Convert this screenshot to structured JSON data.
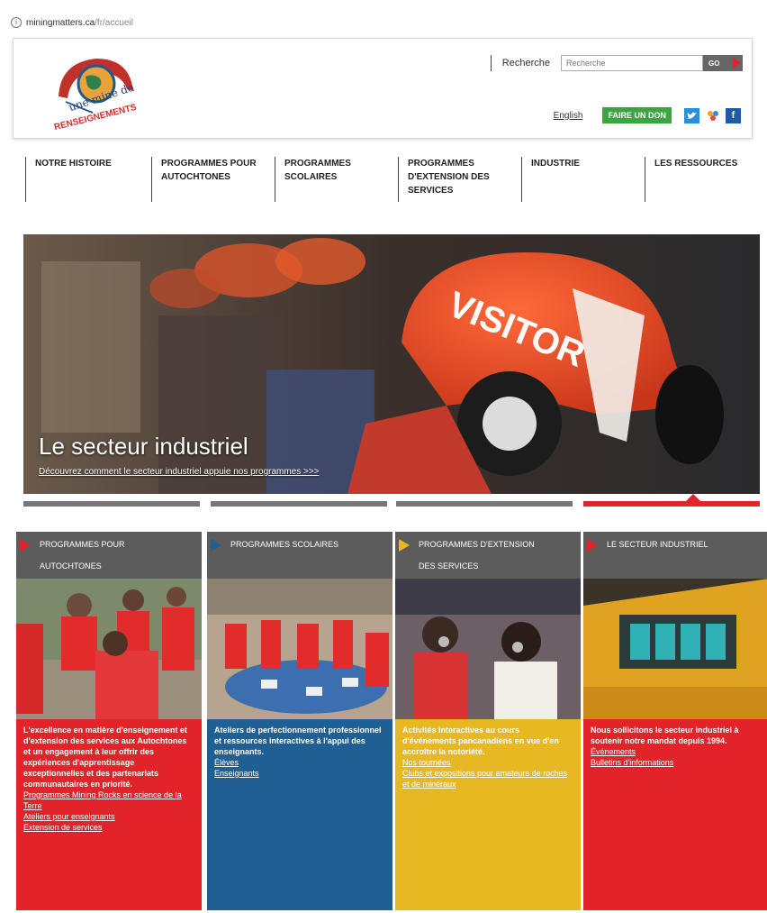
{
  "browser": {
    "url_host": "miningmatters.ca",
    "url_path": "/fr/accueil"
  },
  "header": {
    "logo_line1": "une mine de",
    "logo_line2": "RENSEIGNEMENTS",
    "search_label": "Recherche",
    "search_placeholder": "Recherche",
    "go_label": "GO",
    "english_label": "English",
    "donate_label": "FAIRE UN DON"
  },
  "nav": {
    "items": [
      {
        "label": "NOTRE HISTOIRE"
      },
      {
        "label": "PROGRAMMES POUR AUTOCHTONES"
      },
      {
        "label": "PROGRAMMES SCOLAIRES"
      },
      {
        "label": "PROGRAMMES D'EXTENSION DES SERVICES"
      },
      {
        "label": "INDUSTRIE"
      },
      {
        "label": "LES RESSOURCES"
      }
    ]
  },
  "hero": {
    "title": "Le secteur industriel",
    "subtitle": "Découvrez comment le secteur industriel appuie nos programmes >>>",
    "helmet_text": "VISITOR",
    "active_slide": 4,
    "slide_count": 4
  },
  "cards": [
    {
      "title_line1": "PROGRAMMES POUR",
      "title_line2": "AUTOCHTONES",
      "description": "L'excellence en matière d'enseignement et d'extension des services aux Autochtones et un engagement à leur offrir des expériences d'apprentissage exceptionnelles et des partenariats communautaires en priorité.",
      "links": [
        "Programmes Mining Rocks en science de la Terre",
        "Ateliers pour enseignants",
        "Extension de services"
      ],
      "color": "#e2242a"
    },
    {
      "title_line1": "PROGRAMMES SCOLAIRES",
      "title_line2": "",
      "description": "Ateliers de perfectionnement professionnel et ressources interactives à l'appui des enseignants.",
      "links": [
        "Élèves",
        "Enseignants"
      ],
      "color": "#1f5f94"
    },
    {
      "title_line1": "PROGRAMMES D'EXTENSION",
      "title_line2": "DES SERVICES",
      "description": "Activités interactives au cours d'événements pancanadiens en vue d'en accroître la notoriété.",
      "links": [
        "Nos tournées",
        "Clubs et expositions pour amateurs de roches et de minéraux"
      ],
      "color": "#e7b822"
    },
    {
      "title_line1": "LE SECTEUR INDUSTRIEL",
      "title_line2": "",
      "description": "Nous sollicitons le secteur industriel à soutenir notre mandat depuis 1994.",
      "links": [
        "Événements",
        "Bulletins d'informations"
      ],
      "color": "#e2242a"
    }
  ]
}
